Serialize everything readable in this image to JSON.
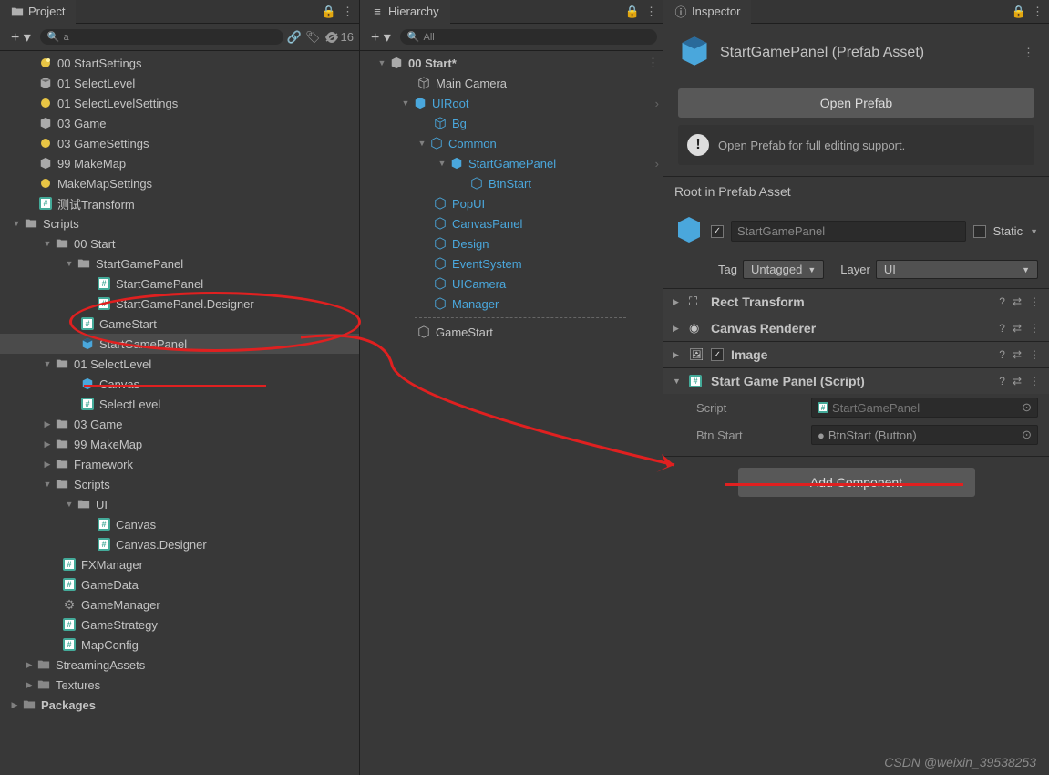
{
  "project": {
    "tab": "Project",
    "search_prefix": "a",
    "hidden_count": "16",
    "tree": {
      "scenes": [
        {
          "name": "00 StartSettings",
          "icon": "lighting"
        },
        {
          "name": "01 SelectLevel",
          "icon": "unity"
        },
        {
          "name": "01 SelectLevelSettings",
          "icon": "lighting"
        },
        {
          "name": "03 Game",
          "icon": "unity"
        },
        {
          "name": "03 GameSettings",
          "icon": "lighting"
        },
        {
          "name": "99 MakeMap",
          "icon": "unity"
        },
        {
          "name": "MakeMapSettings",
          "icon": "lighting"
        },
        {
          "name": "测试Transform",
          "icon": "cs"
        }
      ],
      "scripts_folder": "Scripts",
      "start_folder": "00 Start",
      "sgp_folder": "StartGamePanel",
      "sgp_files": {
        "cs1": "StartGamePanel",
        "cs2": "StartGamePanel.Designer"
      },
      "gamestart": "GameStart",
      "sgp_prefab": "StartGamePanel",
      "selectlevel_folder": "01 SelectLevel",
      "canvas_prefab": "Canvas",
      "selectlevel_cs": "SelectLevel",
      "other_folders": {
        "a": "03 Game",
        "b": "99 MakeMap",
        "c": "Framework"
      },
      "scripts2": "Scripts",
      "ui_folder": "UI",
      "ui_files": {
        "c1": "Canvas",
        "c2": "Canvas.Designer"
      },
      "loose_cs": {
        "a": "FXManager",
        "b": "GameData",
        "c": "GameManager",
        "d": "GameStrategy",
        "e": "MapConfig"
      },
      "streaming": "StreamingAssets",
      "textures": "Textures",
      "packages": "Packages"
    }
  },
  "hierarchy": {
    "tab": "Hierarchy",
    "search": "All",
    "scene": "00 Start*",
    "items": {
      "maincam": "Main Camera",
      "uiroot": "UIRoot",
      "bg": "Bg",
      "common": "Common",
      "sgp": "StartGamePanel",
      "btnstart": "BtnStart",
      "popui": "PopUI",
      "canvaspanel": "CanvasPanel",
      "design": "Design",
      "eventsystem": "EventSystem",
      "uicamera": "UICamera",
      "manager": "Manager",
      "gamestart": "GameStart"
    }
  },
  "inspector": {
    "tab": "Inspector",
    "title": "StartGamePanel (Prefab Asset)",
    "open_prefab": "Open Prefab",
    "info": "Open Prefab for full editing support.",
    "root_section": "Root in Prefab Asset",
    "name_value": "StartGamePanel",
    "static_label": "Static",
    "tag_label": "Tag",
    "tag_value": "Untagged",
    "layer_label": "Layer",
    "layer_value": "UI",
    "components": {
      "rect": "Rect Transform",
      "canvasr": "Canvas Renderer",
      "image": "Image",
      "script": "Start Game Panel (Script)"
    },
    "props": {
      "script_label": "Script",
      "script_value": "StartGamePanel",
      "btn_label": "Btn Start",
      "btn_value": "BtnStart (Button)"
    },
    "add_component": "Add Component"
  },
  "watermark": "CSDN @weixin_39538253"
}
